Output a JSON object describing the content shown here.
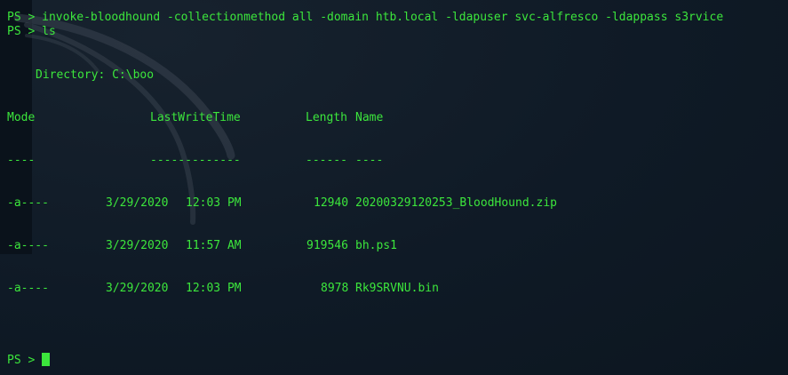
{
  "terminal": {
    "prompt": "PS > ",
    "command_1": "invoke-bloodhound -collectionmethod all -domain htb.local -ldapuser svc-alfresco -ldappass s3rvice",
    "command_2": "ls",
    "directory_line": "Directory: C:\\boo",
    "headers": {
      "mode": "Mode",
      "lastwritetime": "LastWriteTime",
      "length": "Length",
      "name": "Name"
    },
    "underlines": {
      "mode": "----",
      "lastwritetime": "-------------",
      "length": "------",
      "name": "----"
    },
    "files": [
      {
        "mode": "-a----",
        "date": "3/29/2020",
        "time": "12:03 PM",
        "length": "12940",
        "name": "20200329120253_BloodHound.zip"
      },
      {
        "mode": "-a----",
        "date": "3/29/2020",
        "time": "11:57 AM",
        "length": "919546",
        "name": "bh.ps1"
      },
      {
        "mode": "-a----",
        "date": "3/29/2020",
        "time": "12:03 PM",
        "length": "8978",
        "name": "Rk9SRVNU.bin"
      }
    ],
    "final_prompt": "PS > "
  },
  "colors": {
    "text": "#3ce63c",
    "background": "#0f1a26"
  }
}
